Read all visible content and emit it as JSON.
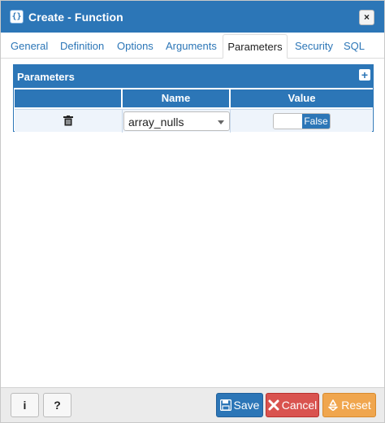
{
  "window": {
    "title": "Create - Function",
    "close_label": "×"
  },
  "tabs": [
    {
      "label": "General"
    },
    {
      "label": "Definition"
    },
    {
      "label": "Options"
    },
    {
      "label": "Arguments"
    },
    {
      "label": "Parameters",
      "active": true
    },
    {
      "label": "Security"
    },
    {
      "label": "SQL"
    }
  ],
  "parameters": {
    "title": "Parameters",
    "add_label": "+",
    "columns": [
      "Name",
      "Value"
    ],
    "rows": [
      {
        "name": "array_nulls",
        "value": "False"
      }
    ]
  },
  "footer": {
    "info_label": "i",
    "help_label": "?",
    "save_label": "Save",
    "cancel_label": "Cancel",
    "reset_label": "Reset"
  },
  "colors": {
    "accent": "#2c76b7",
    "cancel": "#d9534f",
    "reset": "#f0a64e"
  },
  "icons": {
    "title": "function-icon",
    "delete": "trash-icon",
    "save": "floppy-icon",
    "cancel": "x-icon",
    "reset": "recycle-icon"
  }
}
